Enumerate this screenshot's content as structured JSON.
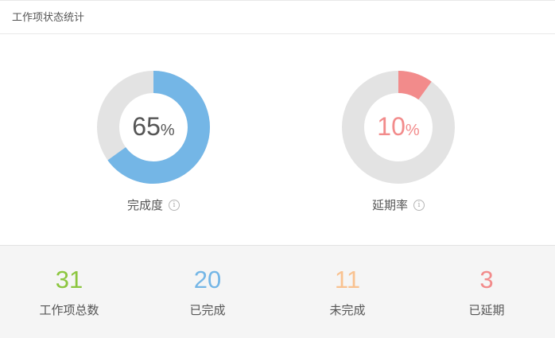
{
  "header": {
    "title": "工作项状态统计"
  },
  "completion": {
    "value": "65",
    "unit": "%",
    "label": "完成度",
    "fraction": 0.65,
    "color": "#74b6e6",
    "track_color": "#e3e3e3",
    "info_icon": "info-icon"
  },
  "delay": {
    "value": "10",
    "unit": "%",
    "label": "延期率",
    "fraction": 0.1,
    "color": "#f28b8b",
    "track_color": "#e3e3e3",
    "info_icon": "info-icon"
  },
  "stats": [
    {
      "value": "31",
      "label": "工作项总数",
      "color": "#8cc63f"
    },
    {
      "value": "20",
      "label": "已完成",
      "color": "#74b6e6"
    },
    {
      "value": "11",
      "label": "未完成",
      "color": "#f9c290"
    },
    {
      "value": "3",
      "label": "已延期",
      "color": "#f28b8b"
    }
  ],
  "colors": {
    "value_text_completion": "#555555",
    "value_text_delay": "#f28b8b"
  }
}
